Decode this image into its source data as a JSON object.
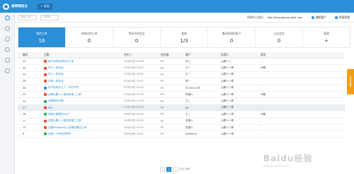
{
  "app": {
    "name": "易帮帮知台",
    "add_label": "+ 添加"
  },
  "filter": {
    "placeholder1": "筛选工单",
    "placeholder2": "分类筛"
  },
  "help": {
    "label": "帮助中心网址：",
    "url": "http://bangbang.ewei.com"
  },
  "topright": {
    "notify": "通知客户",
    "user": "易帮帮客"
  },
  "stats": [
    {
      "label": "我的工单",
      "value": "16"
    },
    {
      "label": "待响应的工单",
      "value": "0"
    },
    {
      "label": "等待中的会话",
      "value": "0"
    },
    {
      "label": "客服",
      "value": "1/3"
    },
    {
      "label": "最近新增的客户",
      "value": "0"
    },
    {
      "label": "日志会话",
      "value": "0"
    },
    {
      "label": "管理",
      "value": "+"
    }
  ],
  "table": {
    "headers": {
      "id": "编号",
      "title": "主题",
      "time": "更新于",
      "priority": "优先级",
      "customer": "客户",
      "owner": "处理人",
      "type": "类型"
    },
    "rows": [
      {
        "id": "42",
        "tag": "red",
        "title": "客户回馈处理中的工单",
        "time": "12月22日 10:06",
        "priority": "P1",
        "customer": "张三",
        "owner": "山鹏十八",
        "type": "-"
      },
      {
        "id": "40",
        "tag": "red",
        "title": "问三一的会话",
        "time": "07月14日 13:51",
        "priority": "P1",
        "customer": "王一",
        "owner": "山鹏十八等",
        "type": "问题"
      },
      {
        "id": "39",
        "tag": "red",
        "title": "问三一的会话",
        "time": "07月14日 13:51",
        "priority": "P1",
        "customer": "王一",
        "owner": "山鹏十八等",
        "type": "-"
      },
      {
        "id": "38",
        "tag": "red",
        "title": "问周一的会话",
        "time": "07月14日 13:51",
        "priority": "P1",
        "customer": "周一",
        "owner": "山鹏十八等",
        "type": "-"
      },
      {
        "id": "36",
        "tag": "blue",
        "title": "好不容易买上了，却打不开",
        "time": "07月14日 11:52",
        "priority": "P1",
        "customer": "823431198",
        "owner": "山鹏十八等",
        "type": "-"
      },
      {
        "id": "35",
        "tag": "red",
        "title": "这是山鹏十八推送的第二工单",
        "time": "07月14日 11:49",
        "priority": "P1",
        "customer": "机器人",
        "owner": "山鹏十八等",
        "type": "问题"
      },
      {
        "id": "34",
        "tag": "green",
        "title": "回单操作问题",
        "time": "07月14日 11:49",
        "priority": "P1",
        "customer": "王二",
        "owner": "山鹏十八等",
        "type": "-"
      },
      {
        "id": "37",
        "tag": "red",
        "title": "dfg",
        "time": "07月18日 10:34",
        "priority": "P1",
        "customer": "djf",
        "owner": "山鹏十八等",
        "type": "-"
      },
      {
        "id": "18",
        "tag": "green",
        "title": "请有小数据怎么办？",
        "time": "03月23日 16:40",
        "priority": "P1",
        "customer": "王二",
        "owner": "山鹏十八等",
        "type": "问题"
      },
      {
        "id": "17",
        "tag": "red",
        "title": "这是山鹏十八推送的第三工单",
        "time": "03月20日 15:32",
        "priority": "P1",
        "customer": "机器人",
        "owner": "山鹏十八等",
        "type": "-"
      },
      {
        "id": "15",
        "tag": "red",
        "title": "这是bangbang上创建的第四工单",
        "time": "03月20日 14:13",
        "priority": "P1",
        "customer": "机器人",
        "owner": "山鹏十八等",
        "type": "-"
      },
      {
        "id": "6",
        "tag": "green",
        "title": "这是一个测试的帮号",
        "time": "03月18日 10:51",
        "priority": "P1",
        "customer": "gbbbang",
        "owner": "山鹏十八等",
        "type": "-"
      }
    ]
  },
  "float_label": "在线客服",
  "pager": {
    "prev": "‹",
    "current": "1",
    "next": "›",
    "total": "共计16条"
  },
  "watermark": {
    "main": "Baidu经验",
    "sub": "jingyan.baidu.com"
  }
}
